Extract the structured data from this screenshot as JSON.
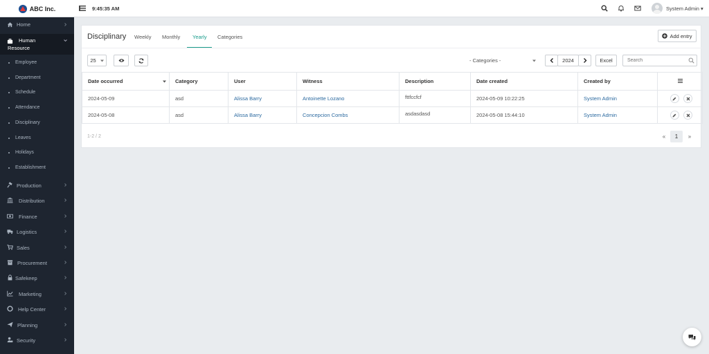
{
  "brand": {
    "name": "ABC Inc."
  },
  "topbar": {
    "clock": "9:45:35 AM",
    "user_name": "System Admin"
  },
  "sidebar": {
    "items": [
      {
        "label": "Home",
        "icon": "home-icon"
      },
      {
        "label": "Human Resource",
        "icon": "briefcase-icon",
        "expanded": true
      },
      {
        "label": "Production",
        "icon": "gavel-icon"
      },
      {
        "label": "Distribution",
        "icon": "bank-icon"
      },
      {
        "label": "Finance",
        "icon": "money-icon"
      },
      {
        "label": "Logistics",
        "icon": "truck-icon"
      },
      {
        "label": "Sales",
        "icon": "cart-icon"
      },
      {
        "label": "Procurement",
        "icon": "box-icon"
      },
      {
        "label": "Safekeep",
        "icon": "lock-icon"
      },
      {
        "label": "Marketing",
        "icon": "chart-icon"
      },
      {
        "label": "Help Center",
        "icon": "lifebuoy-icon"
      },
      {
        "label": "Planning",
        "icon": "send-icon"
      },
      {
        "label": "Security",
        "icon": "user-lock-icon"
      }
    ],
    "hr_label_line1": "Human",
    "hr_label_line2": "Resource",
    "subitems": [
      "Employee",
      "Department",
      "Schedule",
      "Attendance",
      "Disciplinary",
      "Leaves",
      "Holidays",
      "Establishment"
    ]
  },
  "page": {
    "title": "Disciplinary",
    "tabs": [
      "Weekly",
      "Monthly",
      "Yearly",
      "Categories"
    ],
    "active_tab": "Yearly",
    "add_button": "Add entry"
  },
  "toolbar": {
    "page_size": "25",
    "category_placeholder": "- Categories -",
    "year": "2024",
    "excel_label": "Excel",
    "search_placeholder": "Search"
  },
  "table": {
    "columns": [
      "Date occurred",
      "Category",
      "User",
      "Witness",
      "Description",
      "Date created",
      "Created by"
    ],
    "rows": [
      {
        "date_occurred": "2024-05-09",
        "category": "asd",
        "user": "Alissa Barry",
        "witness": "Antoinette Lozano",
        "description": "fttfccfcf",
        "date_created": "2024-05-09 10:22:25",
        "created_by": "System Admin"
      },
      {
        "date_occurred": "2024-05-08",
        "category": "asd",
        "user": "Alissa Barry",
        "witness": "Concepcion Combs",
        "description": "asdasdasd",
        "date_created": "2024-05-08 15:44:10",
        "created_by": "System Admin"
      }
    ]
  },
  "footer": {
    "count_text": "1-2 / 2",
    "pagination": {
      "first": "«",
      "current": "1",
      "last": "»"
    }
  },
  "colors": {
    "accent": "#1a9c8c",
    "link": "#2c6aa0",
    "sidebar_bg": "#1e2530"
  }
}
